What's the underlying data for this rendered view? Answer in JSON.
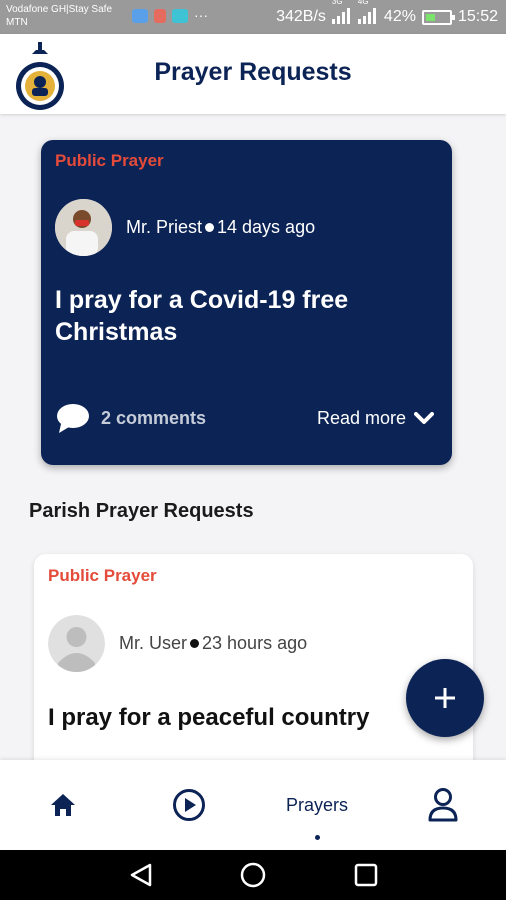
{
  "status_bar": {
    "carrier_line1": "Vodafone GH|Stay Safe",
    "carrier_line2": "MTN",
    "speed": "342B/s",
    "net1": "3G",
    "net2": "4G",
    "battery": "42%",
    "battery_level": 0.42,
    "time": "15:52"
  },
  "header": {
    "title": "Prayer Requests"
  },
  "featured": {
    "tag": "Public Prayer",
    "author": "Mr. Priest",
    "time": "14 days ago",
    "title": "I pray for a Covid-19 free Christmas",
    "comments": "2 comments",
    "read_more": "Read more"
  },
  "section": {
    "title": "Parish Prayer Requests"
  },
  "request": {
    "tag": "Public Prayer",
    "author": "Mr. User",
    "time": "23 hours ago",
    "title": "I pray for a peaceful country"
  },
  "bottom_nav": {
    "prayers": "Prayers"
  },
  "colors": {
    "navy": "#0b2355",
    "tag_red": "#e44b3a",
    "background": "#f4f4f6"
  }
}
